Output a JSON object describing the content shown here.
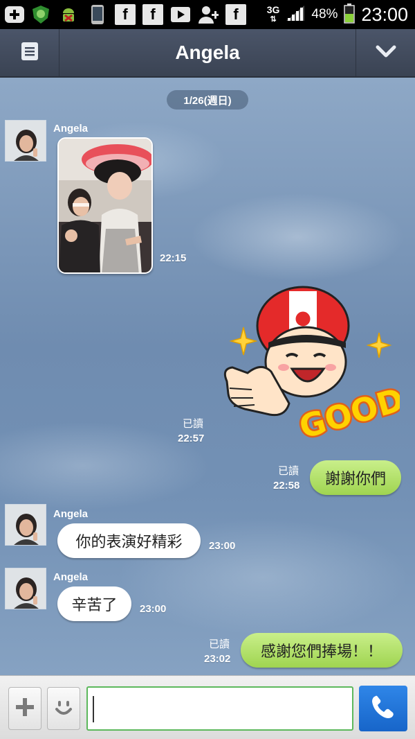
{
  "status_bar": {
    "network": "3G",
    "battery_percent": "48%",
    "time": "23:00",
    "icons": [
      "add-icon",
      "shield-icon",
      "android-icon",
      "phone-icon",
      "facebook-icon",
      "facebook-icon",
      "play-icon",
      "add-contact-icon",
      "facebook-icon",
      "signal-icon",
      "battery-icon"
    ]
  },
  "header": {
    "title": "Angela",
    "menu_icon": "menu-icon",
    "expand_icon": "chevron-down-icon"
  },
  "chat": {
    "date_divider": "1/26(週日)",
    "messages": [
      {
        "from": "Angela",
        "type": "photo",
        "time": "22:15"
      },
      {
        "from": "me",
        "type": "sticker",
        "sticker_text": "GOOD!",
        "read_label": "已讀",
        "time": "22:57"
      },
      {
        "from": "me",
        "type": "text",
        "text": "謝謝你們",
        "read_label": "已讀",
        "time": "22:58"
      },
      {
        "from": "Angela",
        "type": "text",
        "text": "你的表演好精彩",
        "time": "23:00"
      },
      {
        "from": "Angela",
        "type": "text",
        "text": "辛苦了",
        "time": "23:00"
      },
      {
        "from": "me",
        "type": "text",
        "text": "感謝您們捧場！！",
        "read_label": "已讀",
        "time": "23:02"
      }
    ]
  },
  "input_bar": {
    "value": "",
    "add_icon": "plus-icon",
    "emoji_icon": "smiley-icon",
    "call_icon": "phone-icon"
  },
  "colors": {
    "header": "#414a5c",
    "outgoing_bubble": "#a8dc5c",
    "incoming_bubble": "#ffffff",
    "call_button": "#1f74db"
  }
}
